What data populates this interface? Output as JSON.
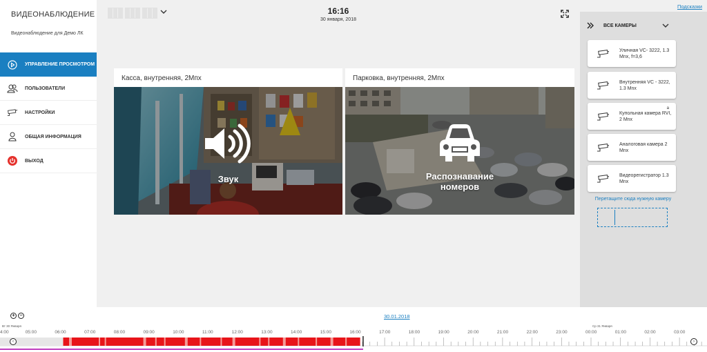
{
  "app": {
    "brand": "ВИДЕОНАБЛЮДЕНИЕ",
    "subtitle": "Видеонаблюдение для Демо ЛК"
  },
  "nav": [
    {
      "label": "УПРАВЛЕНИЕ ПРОСМОТРОМ",
      "icon": "play-circle-icon",
      "active": true
    },
    {
      "label": "ПОЛЬЗОВАТЕЛИ",
      "icon": "users-icon"
    },
    {
      "label": "НАСТРОЙКИ",
      "icon": "camera-settings-icon"
    },
    {
      "label": "ОБЩАЯ ИНФОРМАЦИЯ",
      "icon": "user-info-icon"
    },
    {
      "label": "ВЫХОД",
      "icon": "power-icon"
    }
  ],
  "header": {
    "time": "16:16",
    "date": "30 января, 2018"
  },
  "cameras_view": [
    {
      "title": "Касса, внутренняя, 2Мпх",
      "feature": "Звук",
      "icon": "speaker-icon"
    },
    {
      "title": "Парковка, внутренняя, 2Мпх",
      "feature": "Распознавание номеров",
      "icon": "car-plate-icon"
    }
  ],
  "right_panel": {
    "hints": "Подсказки",
    "title": "ВСЕ КАМЕРЫ",
    "cameras": [
      {
        "name": "Уличная VC- 3222, 1.3 Mnx, f=3,6"
      },
      {
        "name": "Внутренняя VC - 3222, 1.3 Mnx"
      },
      {
        "name": "Купольная камера RVI, 2 Mnx",
        "sup": "a"
      },
      {
        "name": "Аналоговая камера 2 Mnx"
      },
      {
        "name": "Видеорегистратор 1.3 Mnx"
      }
    ],
    "drop_hint": "Перетащите сюда нужную камеру"
  },
  "timeline": {
    "date_link": "30.01.2018",
    "day_labels": [
      "Вт 30 Января",
      "Ср 31 Января"
    ],
    "hours": [
      "4:00",
      "05:00",
      "06:00",
      "07:00",
      "08:00",
      "09:00",
      "10:00",
      "11:00",
      "12:00",
      "13:00",
      "14:00",
      "15:00",
      "16:00",
      "17:00",
      "18:00",
      "19:00",
      "20:00",
      "21:00",
      "22:00",
      "23:00",
      "00:00",
      "01:00",
      "02:00",
      "03:00"
    ],
    "recording_range": [
      6.0,
      16.17
    ],
    "current_time": 16.27,
    "colors": {
      "recording": "#e8141a",
      "light": "#f6b5b0",
      "progress": "#c03cbf",
      "accent": "#1a7fc1"
    }
  }
}
